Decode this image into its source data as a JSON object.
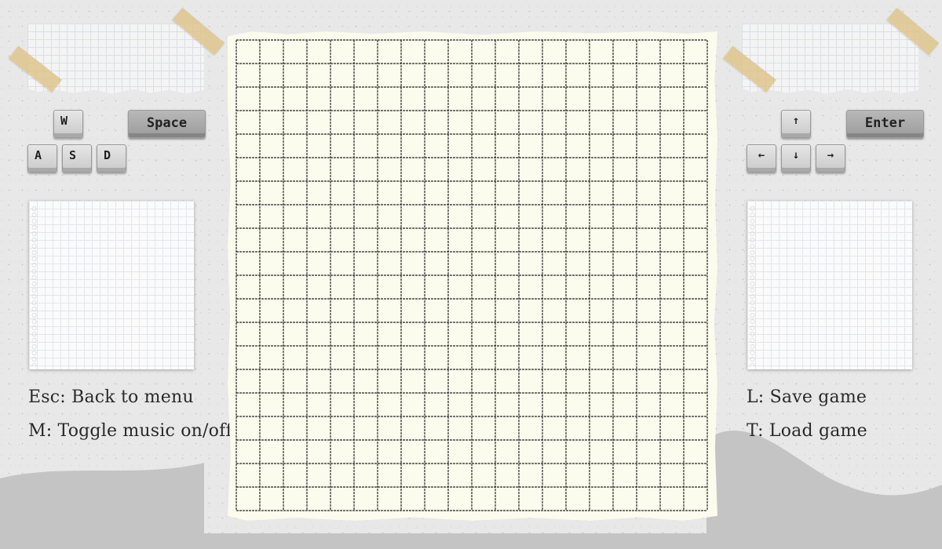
{
  "left_panel": {
    "keys": {
      "up": "W",
      "left": "A",
      "down": "S",
      "right": "D",
      "action": "Space"
    },
    "hints": [
      "Esc: Back to menu",
      "M: Toggle music on/off"
    ]
  },
  "right_panel": {
    "keys": {
      "up": "↑",
      "left": "←",
      "down": "↓",
      "right": "→",
      "action": "Enter"
    },
    "hints": [
      "L: Save game",
      "T: Load game"
    ]
  },
  "board": {
    "columns": 20,
    "rows": 20,
    "line_color": "#2b2b2b",
    "paper_color": "#fbfbee"
  },
  "colors": {
    "background": "#e8e8e8",
    "hills": "#c4c4c4"
  }
}
